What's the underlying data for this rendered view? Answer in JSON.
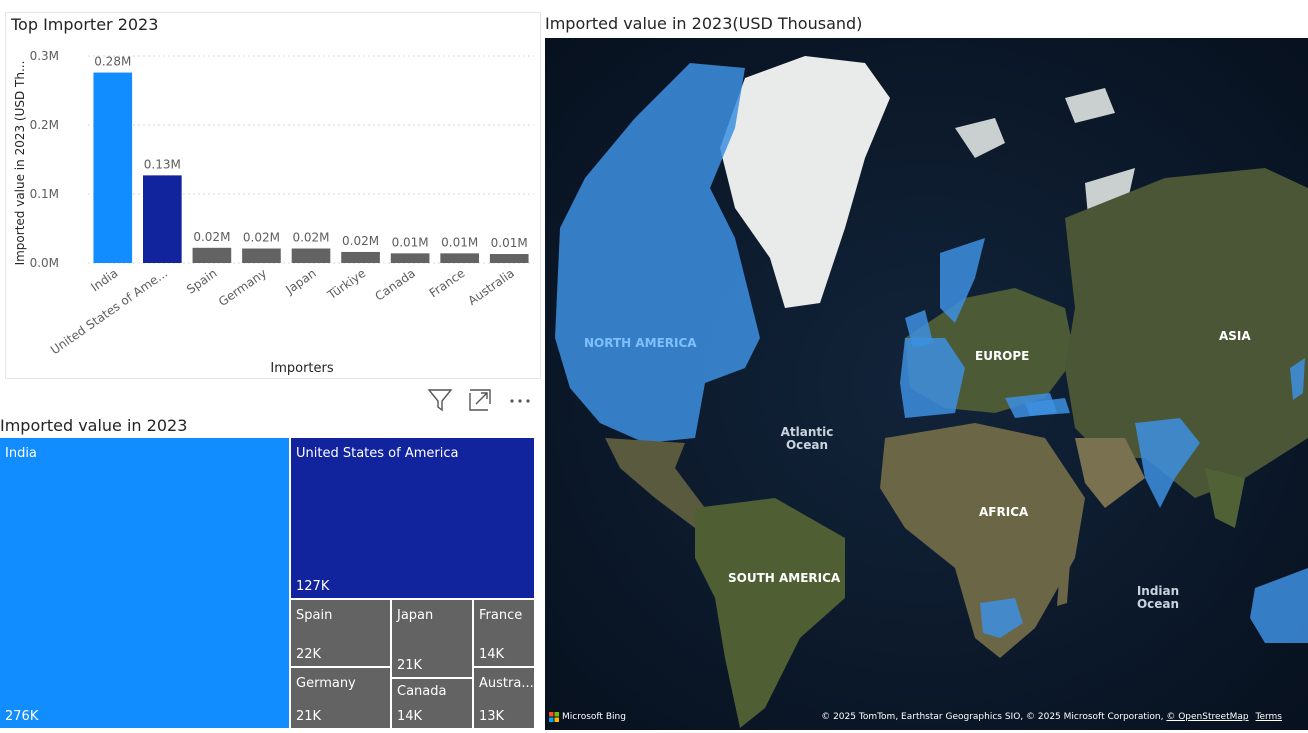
{
  "bar_chart": {
    "title": "Top Importer 2023"
  },
  "chart_data": {
    "type": "bar",
    "title": "Top Importer 2023",
    "xlabel": "Importers",
    "ylabel": "Imported value in 2023 (USD Th...",
    "ylim": [
      0,
      0.3
    ],
    "yticks": [
      "0.0M",
      "0.1M",
      "0.2M",
      "0.3M"
    ],
    "ytick_values": [
      0,
      0.1,
      0.2,
      0.3
    ],
    "grid": true,
    "categories": [
      "India",
      "United States of Ame...",
      "Spain",
      "Germany",
      "Japan",
      "Türkiye",
      "Canada",
      "France",
      "Australia"
    ],
    "values": [
      0.276,
      0.127,
      0.022,
      0.021,
      0.021,
      0.016,
      0.014,
      0.014,
      0.013
    ],
    "data_labels": [
      "0.28M",
      "0.13M",
      "0.02M",
      "0.02M",
      "0.02M",
      "0.02M",
      "0.01M",
      "0.01M",
      "0.01M"
    ],
    "colors": [
      "#118DFF",
      "#12239E",
      "#636363",
      "#636363",
      "#636363",
      "#636363",
      "#636363",
      "#636363",
      "#636363"
    ]
  },
  "treemap": {
    "title": "Imported value in 2023",
    "tiles": [
      {
        "label": "India",
        "value": "276K",
        "color": "#118DFF"
      },
      {
        "label": "United States of America",
        "value": "127K",
        "color": "#12239E"
      },
      {
        "label": "Spain",
        "value": "22K",
        "color": "#636363"
      },
      {
        "label": "Germany",
        "value": "21K",
        "color": "#636363"
      },
      {
        "label": "Japan",
        "value": "21K",
        "color": "#636363"
      },
      {
        "label": "Canada",
        "value": "14K",
        "color": "#636363"
      },
      {
        "label": "France",
        "value": "14K",
        "color": "#636363"
      },
      {
        "label": "Austra...",
        "value": "13K",
        "color": "#636363"
      }
    ]
  },
  "visual_header": {
    "icons": [
      "filter-icon",
      "focus-mode-icon",
      "more-options-icon"
    ]
  },
  "map": {
    "title": "Imported value in 2023(USD Thousand)",
    "labels": {
      "north_america": "NORTH AMERICA",
      "europe": "EUROPE",
      "asia": "ASIA",
      "atlantic": "Atlantic Ocean",
      "africa": "AFRICA",
      "south_america": "SOUTH AMERICA",
      "indian": "Indian Ocean"
    },
    "highlight_color": "#3d8fe0",
    "attribution": {
      "brand": "Microsoft Bing",
      "copyright": "© 2025 TomTom, Earthstar Geographics SIO, © 2025 Microsoft Corporation,",
      "osm_link": "© OpenStreetMap",
      "terms_link": "Terms"
    }
  }
}
